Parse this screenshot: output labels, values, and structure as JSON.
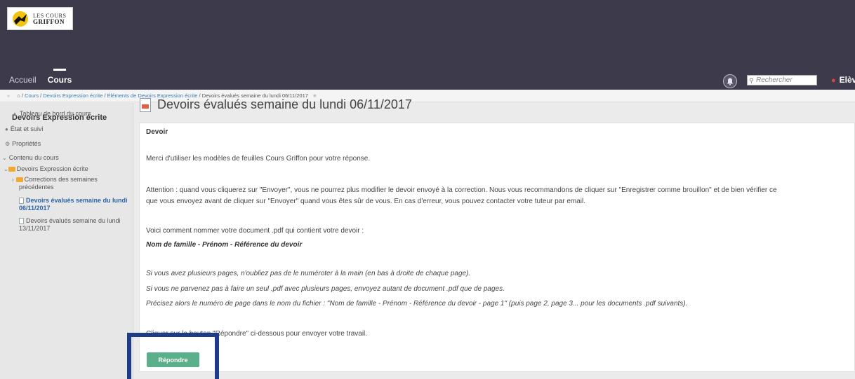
{
  "header": {
    "logo_line1": "LES COURS",
    "logo_line2": "GRIFFON",
    "nav": [
      {
        "label": "Accueil"
      },
      {
        "label": "Cours"
      }
    ],
    "search_placeholder": "Rechercher",
    "user_label": "Elèv"
  },
  "breadcrumb": {
    "items": [
      "Cours",
      "Devoirs Expression écrite",
      "Éléments de Devoirs Expression écrite"
    ],
    "current": "Devoirs évalués semaine du lundi 06/11/2017"
  },
  "sidebar": {
    "title": "Devoirs Expression écrite",
    "dashboard": "Tableau de bord du cours",
    "tracking": "État et suivi",
    "properties": "Propriétés",
    "content": "Contenu du cours",
    "folder": "Devoirs Expression écrite",
    "corrections_line1": "Corrections des semaines",
    "corrections_line2": "précédentes",
    "current_line1": "Devoirs évalués semaine du lundi",
    "current_line2": "06/11/2017",
    "next_line1": "Devoirs évalués semaine du lundi",
    "next_line2": "13/11/2017"
  },
  "main": {
    "title": "Devoirs évalués semaine du lundi 06/11/2017",
    "card_title": "Devoir",
    "p1": "Merci d'utiliser les modèles de feuilles Cours Griffon pour votre réponse.",
    "p2a": "Attention : quand vous cliquerez sur \"Envoyer\", vous ne pourrez plus modifier le devoir envoyé à la correction. Nous vous recommandons de cliquer sur \"Enregistrer comme brouillon\" et de bien vérifier ce",
    "p2b": "que vous envoyez avant de cliquer sur \"Envoyer\" quand vous êtes sûr de vous. En cas d'erreur, vous pouvez contacter votre tuteur par email.",
    "p3": "Voici comment nommer votre document .pdf qui contient votre devoir :",
    "p3b": "Nom de famille - Prénom - Référence du devoir",
    "p4a": "Si vous avez plusieurs pages, n'oubliez pas de le numéroter à la main (en bas à droite de chaque page).",
    "p4b": "Si vous ne parvenez pas à faire un seul .pdf avec plusieurs pages, envoyez autant de document .pdf que de pages.",
    "p4c": "Précisez alors le numéro de page dans le nom du fichier : \"Nom de famille - Prénom - Référence du devoir  - page 1\"  (puis page 2, page 3... pour les documents .pdf suivants).",
    "p5": "Cliquer sur le bouton \"Répondre\" ci-dessous pour envoyer votre travail.",
    "reply_button": "Répondre"
  }
}
